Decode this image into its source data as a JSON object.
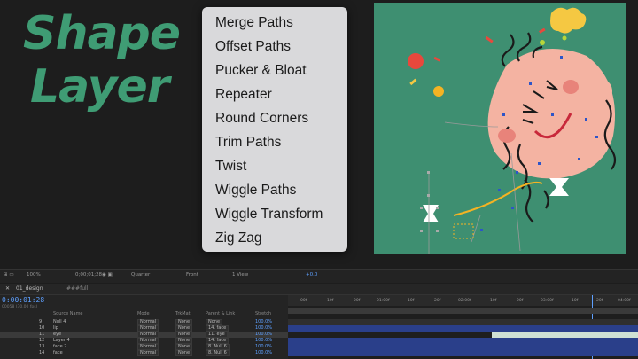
{
  "title": {
    "line1": "Shape",
    "line2": "Layer"
  },
  "menu": {
    "items": [
      "Merge Paths",
      "Offset Paths",
      "Pucker & Bloat",
      "Repeater",
      "Round Corners",
      "Trim Paths",
      "Twist",
      "Wiggle Paths",
      "Wiggle Transform",
      "Zig Zag"
    ]
  },
  "toolbar": {
    "zoom": "100%",
    "timecode": "0;00;01;28",
    "resolution": "Quarter",
    "view": "Front",
    "views": "1 View",
    "offset": "+0.0"
  },
  "tabs": {
    "comp_tab": "01_design",
    "second_tab": "###full"
  },
  "timeline": {
    "current_time": "0:00:01:28",
    "fps": "00058 (30.00 fps)",
    "columns": {
      "source": "Source Name",
      "mode": "Mode",
      "trkmat": "TrkMat",
      "parent": "Parent & Link",
      "stretch": "Stretch"
    },
    "rows": [
      {
        "num": "9",
        "name": "Null 4",
        "mode": "Normal",
        "trk": "None",
        "parent": "None",
        "stretch": "100.0%"
      },
      {
        "num": "10",
        "name": "lip",
        "mode": "Normal",
        "trk": "None",
        "parent": "14. face",
        "stretch": "100.0%"
      },
      {
        "num": "11",
        "name": "eye",
        "mode": "Normal",
        "trk": "None",
        "parent": "11. eye",
        "stretch": "100.0%"
      },
      {
        "num": "12",
        "name": "Layer 4",
        "mode": "Normal",
        "trk": "None",
        "parent": "14. face",
        "stretch": "100.0%"
      },
      {
        "num": "13",
        "name": "face 2",
        "mode": "Normal",
        "trk": "None",
        "parent": "8. Null 6",
        "stretch": "100.0%"
      },
      {
        "num": "14",
        "name": "face",
        "mode": "Normal",
        "trk": "None",
        "parent": "8. Null 6",
        "stretch": "100.0%"
      }
    ],
    "ruler_ticks": [
      "00f",
      "10f",
      "20f",
      "01:00f",
      "10f",
      "20f",
      "02:00f",
      "10f",
      "20f",
      "03:00f",
      "10f",
      "20f",
      "04:00f"
    ]
  },
  "colors": {
    "accent": "#3f9c74",
    "comp_bg": "#3e8f71",
    "face": "#f4b3a2",
    "timecode": "#5ea0ff"
  }
}
